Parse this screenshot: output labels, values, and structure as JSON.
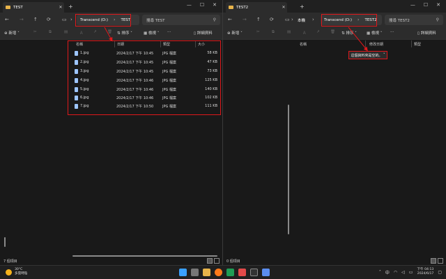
{
  "left_window": {
    "tab_title": "TEST",
    "breadcrumb": [
      "Transcend (D:)",
      "TEST"
    ],
    "search_placeholder": "搜尋 TEST",
    "toolbar": {
      "new_label": "新增",
      "sort_label": "排序",
      "view_label": "檢視",
      "details_label": "詳細資料"
    },
    "columns": [
      "名稱",
      "日期",
      "類型",
      "大小"
    ],
    "files": [
      {
        "name": "1.jpg",
        "date": "2024/2/17 下午 10:45",
        "type": "JPG 檔案",
        "size": "58 KB"
      },
      {
        "name": "2.jpg",
        "date": "2024/2/17 下午 10:45",
        "type": "JPG 檔案",
        "size": "47 KB"
      },
      {
        "name": "3.jpg",
        "date": "2024/2/17 下午 10:45",
        "type": "JPG 檔案",
        "size": "73 KB"
      },
      {
        "name": "4.jpg",
        "date": "2024/2/17 下午 10:46",
        "type": "JPG 檔案",
        "size": "125 KB"
      },
      {
        "name": "5.jpg",
        "date": "2024/2/17 下午 10:46",
        "type": "JPG 檔案",
        "size": "140 KB"
      },
      {
        "name": "6.jpg",
        "date": "2024/2/17 下午 10:46",
        "type": "JPG 檔案",
        "size": "102 KB"
      },
      {
        "name": "7.jpg",
        "date": "2024/2/17 下午 10:50",
        "type": "JPG 檔案",
        "size": "111 KB"
      }
    ],
    "status": "7 個項目"
  },
  "right_window": {
    "tab_title": "TEST2",
    "breadcrumb_prefix": "本機",
    "breadcrumb": [
      "Transcend (D:)",
      "TEST2"
    ],
    "search_placeholder": "搜尋 TEST2",
    "toolbar": {
      "new_label": "新增",
      "sort_label": "排序",
      "view_label": "檢視",
      "details_label": "詳細資料"
    },
    "columns": [
      "名稱",
      "修改日期",
      "類型"
    ],
    "empty_message": "這個資料夾是空的。",
    "status": "0 個項目"
  },
  "taskbar": {
    "weather_temp": "30°C",
    "weather_desc": "多雲時陰",
    "ime_label": "中",
    "time": "下午 04:13",
    "date": "2024/6/17"
  },
  "colors": {
    "accent_red": "#e0181b",
    "folder": "#e8b44a",
    "file_icon": "#9ec6ff"
  }
}
